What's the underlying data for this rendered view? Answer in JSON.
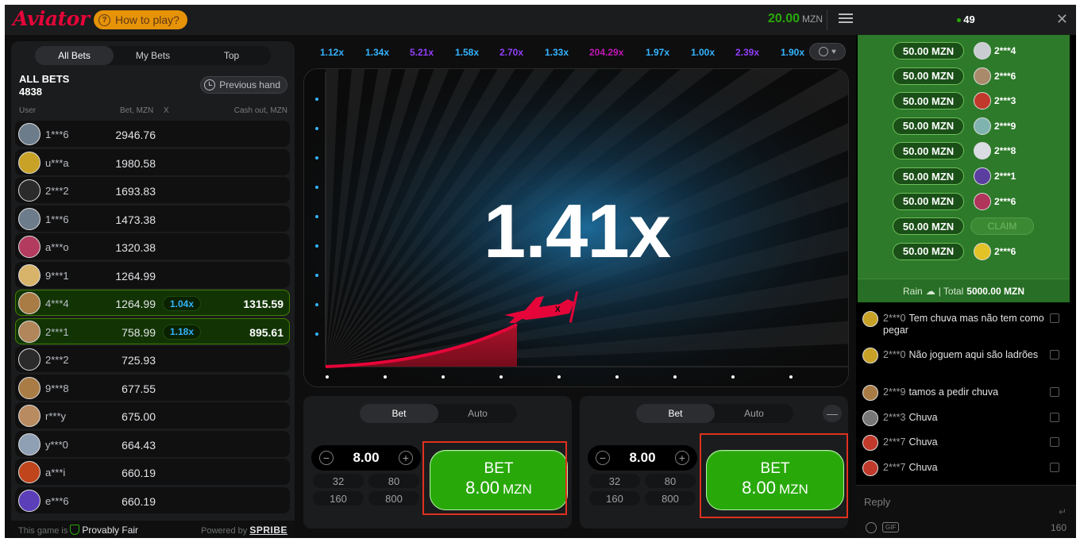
{
  "header": {
    "logo": "Aviator",
    "howto_label": "How to play?",
    "balance": "20.00",
    "currency": "MZN"
  },
  "bets": {
    "tabs": [
      {
        "label": "All Bets",
        "active": true
      },
      {
        "label": "My Bets",
        "active": false
      },
      {
        "label": "Top",
        "active": false
      }
    ],
    "title": "ALL BETS",
    "count": "4838",
    "previous_hand": "Previous hand",
    "columns": {
      "user": "User",
      "bet": "Bet, MZN",
      "x": "X",
      "cashout": "Cash out, MZN"
    },
    "rows": [
      {
        "user": "1***6",
        "bet": "2946.76",
        "mult": "",
        "cash": "",
        "avatar_color": "#6d7c8a"
      },
      {
        "user": "u***a",
        "bet": "1980.58",
        "mult": "",
        "cash": "",
        "avatar_color": "#c8a227"
      },
      {
        "user": "2***2",
        "bet": "1693.83",
        "mult": "",
        "cash": "",
        "avatar_color": "#2b2b2b"
      },
      {
        "user": "1***6",
        "bet": "1473.38",
        "mult": "",
        "cash": "",
        "avatar_color": "#6d7c8a"
      },
      {
        "user": "a***o",
        "bet": "1320.38",
        "mult": "",
        "cash": "",
        "avatar_color": "#b33b5f"
      },
      {
        "user": "9***1",
        "bet": "1264.99",
        "mult": "",
        "cash": "",
        "avatar_color": "#d8b36a"
      },
      {
        "user": "4***4",
        "bet": "1264.99",
        "mult": "1.04x",
        "cash": "1315.59",
        "avatar_color": "#a97c45"
      },
      {
        "user": "2***1",
        "bet": "758.99",
        "mult": "1.18x",
        "cash": "895.61",
        "avatar_color": "#b0865a"
      },
      {
        "user": "2***2",
        "bet": "725.93",
        "mult": "",
        "cash": "",
        "avatar_color": "#2b2b2b"
      },
      {
        "user": "9***8",
        "bet": "677.55",
        "mult": "",
        "cash": "",
        "avatar_color": "#a97c45"
      },
      {
        "user": "r***y",
        "bet": "675.00",
        "mult": "",
        "cash": "",
        "avatar_color": "#b98b60"
      },
      {
        "user": "y***0",
        "bet": "664.43",
        "mult": "",
        "cash": "",
        "avatar_color": "#8fa0b5"
      },
      {
        "user": "a***i",
        "bet": "660.19",
        "mult": "",
        "cash": "",
        "avatar_color": "#c0451c"
      },
      {
        "user": "e***6",
        "bet": "660.19",
        "mult": "",
        "cash": "",
        "avatar_color": "#5b3fb8"
      }
    ],
    "footer_prefix": "This game is",
    "footer_fair": "Provably Fair",
    "footer_powered": "Powered by",
    "footer_brand": "SPRIBE"
  },
  "history": [
    {
      "value": "1.12x",
      "color": "#34b4ff"
    },
    {
      "value": "1.34x",
      "color": "#34b4ff"
    },
    {
      "value": "5.21x",
      "color": "#913ef8"
    },
    {
      "value": "1.58x",
      "color": "#34b4ff"
    },
    {
      "value": "2.70x",
      "color": "#913ef8"
    },
    {
      "value": "1.33x",
      "color": "#34b4ff"
    },
    {
      "value": "204.29x",
      "color": "#c017b4"
    },
    {
      "value": "1.97x",
      "color": "#34b4ff"
    },
    {
      "value": "1.00x",
      "color": "#34b4ff"
    },
    {
      "value": "2.39x",
      "color": "#913ef8"
    },
    {
      "value": "1.90x",
      "color": "#34b4ff"
    }
  ],
  "game": {
    "multiplier": "1.41x"
  },
  "bet_panels": [
    {
      "tabs": [
        "Bet",
        "Auto"
      ],
      "amount": "8.00",
      "chips": [
        "32",
        "80",
        "160",
        "800"
      ],
      "button_line1": "BET",
      "button_amount": "8.00",
      "button_currency": "MZN"
    },
    {
      "tabs": [
        "Bet",
        "Auto"
      ],
      "amount": "8.00",
      "chips": [
        "32",
        "80",
        "160",
        "800"
      ],
      "button_line1": "BET",
      "button_amount": "8.00",
      "button_currency": "MZN",
      "collapse": "—"
    }
  ],
  "chat": {
    "online": "49",
    "rain_rows": [
      {
        "amount": "50.00 MZN",
        "user": "2***4",
        "avatar_color": "#c9cdd2"
      },
      {
        "amount": "50.00 MZN",
        "user": "2***6",
        "avatar_color": "#a98a6a"
      },
      {
        "amount": "50.00 MZN",
        "user": "2***3",
        "avatar_color": "#c0392b"
      },
      {
        "amount": "50.00 MZN",
        "user": "2***9",
        "avatar_color": "#7fb3b0"
      },
      {
        "amount": "50.00 MZN",
        "user": "2***8",
        "avatar_color": "#d9dde3"
      },
      {
        "amount": "50.00 MZN",
        "user": "2***1",
        "avatar_color": "#5a3fa0"
      },
      {
        "amount": "50.00 MZN",
        "user": "2***6",
        "avatar_color": "#b0355a"
      },
      {
        "amount": "50.00 MZN",
        "user": "",
        "claim": "CLAIM"
      },
      {
        "amount": "50.00 MZN",
        "user": "2***6",
        "avatar_color": "#e3c227"
      }
    ],
    "rain_label": "Rain",
    "rain_total_label": "| Total",
    "rain_total": "5000.00 MZN",
    "messages": [
      {
        "user": "2***0",
        "text": "Tem chuva mas não tem como pegar",
        "avatar_color": "#c8a227"
      },
      {
        "user": "2***0",
        "text": "Não joguem aqui são ladrões",
        "avatar_color": "#c8a227"
      },
      {
        "user": "2***9",
        "text": "tamos a pedir chuva",
        "avatar_color": "#a97c45"
      },
      {
        "user": "2***3",
        "text": "Chuva",
        "avatar_color": "#777777"
      },
      {
        "user": "2***7",
        "text": "Chuva",
        "avatar_color": "#c0392b"
      },
      {
        "user": "2***7",
        "text": "Chuva",
        "avatar_color": "#c0392b"
      }
    ],
    "reply_placeholder": "Reply",
    "gif_label": "GIF",
    "char_count": "160"
  }
}
